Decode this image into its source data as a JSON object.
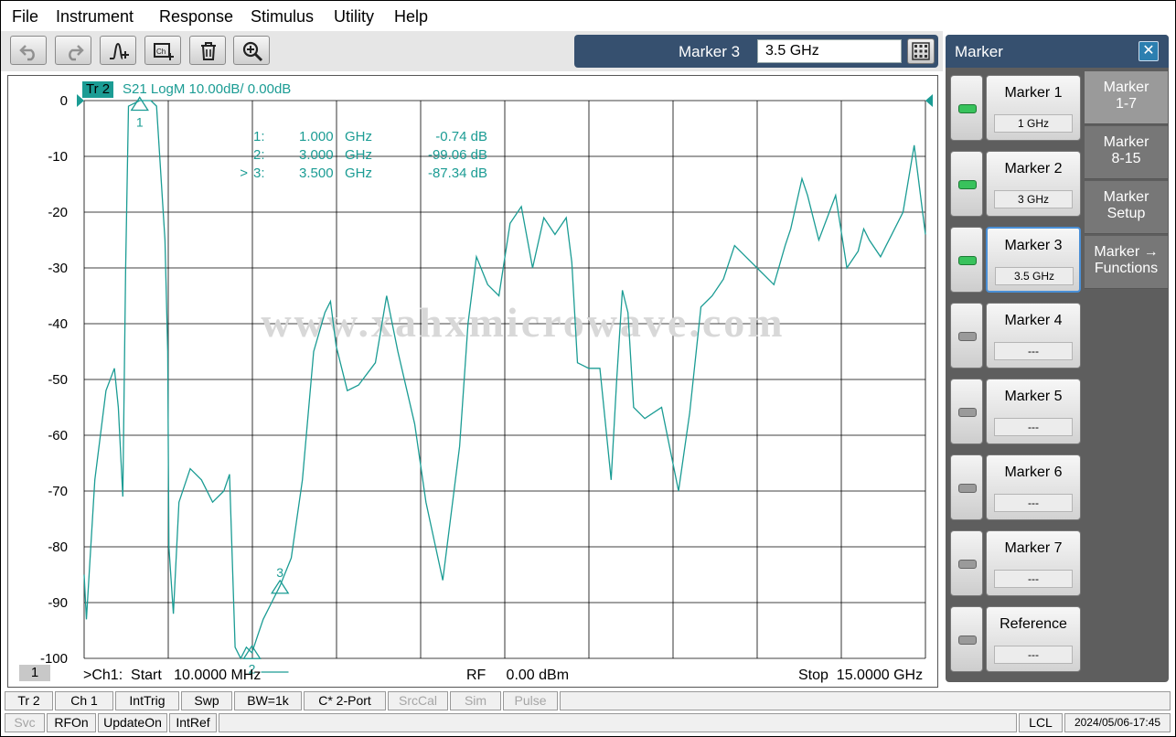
{
  "menu": [
    "File",
    "Instrument",
    "Response",
    "Stimulus",
    "Utility",
    "Help"
  ],
  "toolbar": {
    "buttons": [
      "undo-icon",
      "redo-icon",
      "add-trace-icon",
      "channel-add-icon",
      "delete-icon",
      "zoom-icon"
    ],
    "marker_label": "Marker 3",
    "marker_value": "3.5 GHz"
  },
  "trace": {
    "label": "Tr 2",
    "description": "S21 LogM 10.00dB/  0.00dB",
    "color": "#1b9c94"
  },
  "markers_readout": [
    {
      "id": "1:",
      "freq": "1.000",
      "unit": "GHz",
      "value": "-0.74 dB",
      "active": ""
    },
    {
      "id": "2:",
      "freq": "3.000",
      "unit": "GHz",
      "value": "-99.06 dB",
      "active": ""
    },
    {
      "id": "3:",
      "freq": "3.500",
      "unit": "GHz",
      "value": "-87.34 dB",
      "active": ">"
    }
  ],
  "channel_indicator": "1",
  "bottom": {
    "start": ">Ch1:  Start   10.0000 MHz",
    "rf": "RF     0.00 dBm",
    "stop": "Stop  15.0000 GHz"
  },
  "watermark": "www.xahxmicrowave.com",
  "chart_data": {
    "type": "line",
    "ylabel": "",
    "xlabel": "",
    "y_ticks": [
      "0",
      "-10",
      "-20",
      "-30",
      "-40",
      "-50",
      "-60",
      "-70",
      "-80",
      "-90",
      "-100"
    ],
    "ylim": [
      -100,
      0
    ],
    "xlim_ghz": [
      0.01,
      15.0
    ],
    "grid": true,
    "x_divisions": 10,
    "series": [
      {
        "x": [
          0.01,
          0.05,
          0.2,
          0.4,
          0.55,
          0.62,
          0.7,
          0.75,
          0.8,
          1.0,
          1.2,
          1.3,
          1.45,
          1.5,
          1.52,
          1.6,
          1.7,
          1.9,
          2.1,
          2.3,
          2.5,
          2.6,
          2.7,
          2.8,
          2.9,
          3.0,
          3.1,
          3.2,
          3.35,
          3.5,
          3.7,
          3.9,
          4.1,
          4.3,
          4.4,
          4.5,
          4.7,
          4.9,
          5.2,
          5.4,
          5.6,
          5.9,
          6.1,
          6.4,
          6.7,
          6.85,
          7.0,
          7.2,
          7.4,
          7.6,
          7.8,
          8.0,
          8.2,
          8.4,
          8.6,
          8.7,
          8.8,
          9.0,
          9.2,
          9.4,
          9.5,
          9.6,
          9.7,
          9.8,
          10.0,
          10.3,
          10.6,
          10.8,
          11.0,
          11.2,
          11.4,
          11.6,
          11.8,
          12.0,
          12.3,
          12.5,
          12.6,
          12.8,
          12.9,
          13.1,
          13.4,
          13.6,
          13.8,
          13.9,
          14.0,
          14.2,
          14.3,
          14.4,
          14.6,
          14.8,
          14.95,
          15.0
        ],
        "y": [
          -85,
          -93,
          -68,
          -52,
          -48,
          -55,
          -71,
          -30,
          -1,
          0,
          0,
          -1,
          -25,
          -45,
          -80,
          -92,
          -72,
          -66,
          -68,
          -72,
          -70,
          -67,
          -98,
          -102,
          -98,
          -99,
          -96,
          -93,
          -90,
          -87,
          -82,
          -68,
          -45,
          -38,
          -36,
          -44,
          -52,
          -51,
          -47,
          -35,
          -45,
          -58,
          -72,
          -86,
          -62,
          -40,
          -28,
          -33,
          -35,
          -22,
          -19,
          -30,
          -21,
          -24,
          -21,
          -29,
          -47,
          -48,
          -48,
          -68,
          -50,
          -34,
          -38,
          -55,
          -57,
          -55,
          -70,
          -56,
          -37,
          -35,
          -32,
          -26,
          -28,
          -30,
          -33,
          -26,
          -23,
          -14,
          -17,
          -25,
          -17,
          -30,
          -27,
          -23,
          -25,
          -28,
          -26,
          -24,
          -20,
          -8,
          -20,
          -24
        ]
      }
    ],
    "markers": [
      {
        "label": "1",
        "x": 1.0,
        "y": -0.74
      },
      {
        "label": "3",
        "x": 3.5,
        "y": -87.34
      },
      {
        "label": "2",
        "x": 3.0,
        "y": -99.06
      }
    ]
  },
  "panel": {
    "title": "Marker",
    "rows": [
      {
        "label": "Marker 1",
        "value": "1 GHz",
        "led": true,
        "active": false
      },
      {
        "label": "Marker 2",
        "value": "3 GHz",
        "led": true,
        "active": false
      },
      {
        "label": "Marker 3",
        "value": "3.5 GHz",
        "led": true,
        "active": true
      },
      {
        "label": "Marker 4",
        "value": "---",
        "led": false,
        "active": false
      },
      {
        "label": "Marker 5",
        "value": "---",
        "led": false,
        "active": false
      },
      {
        "label": "Marker 6",
        "value": "---",
        "led": false,
        "active": false
      },
      {
        "label": "Marker 7",
        "value": "---",
        "led": false,
        "active": false
      },
      {
        "label": "Reference",
        "value": "---",
        "led": false,
        "active": false
      }
    ],
    "tabs": [
      {
        "label1": "Marker",
        "label2": "1-7"
      },
      {
        "label1": "Marker",
        "label2": "8-15"
      },
      {
        "label1": "Marker",
        "label2": "Setup"
      },
      {
        "label1": "Marker →",
        "label2": "Functions"
      }
    ]
  },
  "status_row1": [
    "Tr 2",
    "Ch 1",
    "IntTrig",
    "Swp",
    "BW=1k",
    "C* 2-Port",
    "SrcCal",
    "Sim",
    "Pulse"
  ],
  "status_row2": [
    "Svc",
    "RFOn",
    "UpdateOn",
    "IntRef"
  ],
  "status_right": [
    "LCL",
    "2024/05/06-17:45"
  ]
}
